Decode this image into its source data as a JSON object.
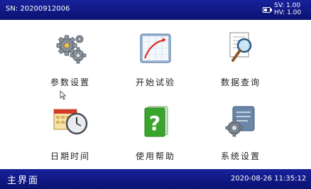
{
  "header": {
    "serial": "SN: 20200912006",
    "sv": "SV: 1.00",
    "hv": "HV: 1.00",
    "battery_icon": "battery-icon"
  },
  "menu": {
    "items": [
      {
        "label": "参数设置",
        "icon": "gears-icon"
      },
      {
        "label": "开始试验",
        "icon": "curve-chart-icon"
      },
      {
        "label": "数据查询",
        "icon": "document-search-icon"
      },
      {
        "label": "日期时间",
        "icon": "calendar-clock-icon"
      },
      {
        "label": "使用帮助",
        "icon": "help-question-icon"
      },
      {
        "label": "系统设置",
        "icon": "system-settings-icon"
      }
    ]
  },
  "footer": {
    "title": "主界面",
    "datetime": "2020-08-26  11:35:12"
  },
  "colors": {
    "bar_blue": "#0f1a86",
    "help_green": "#3aa52c",
    "curve_red": "#d9302a"
  }
}
